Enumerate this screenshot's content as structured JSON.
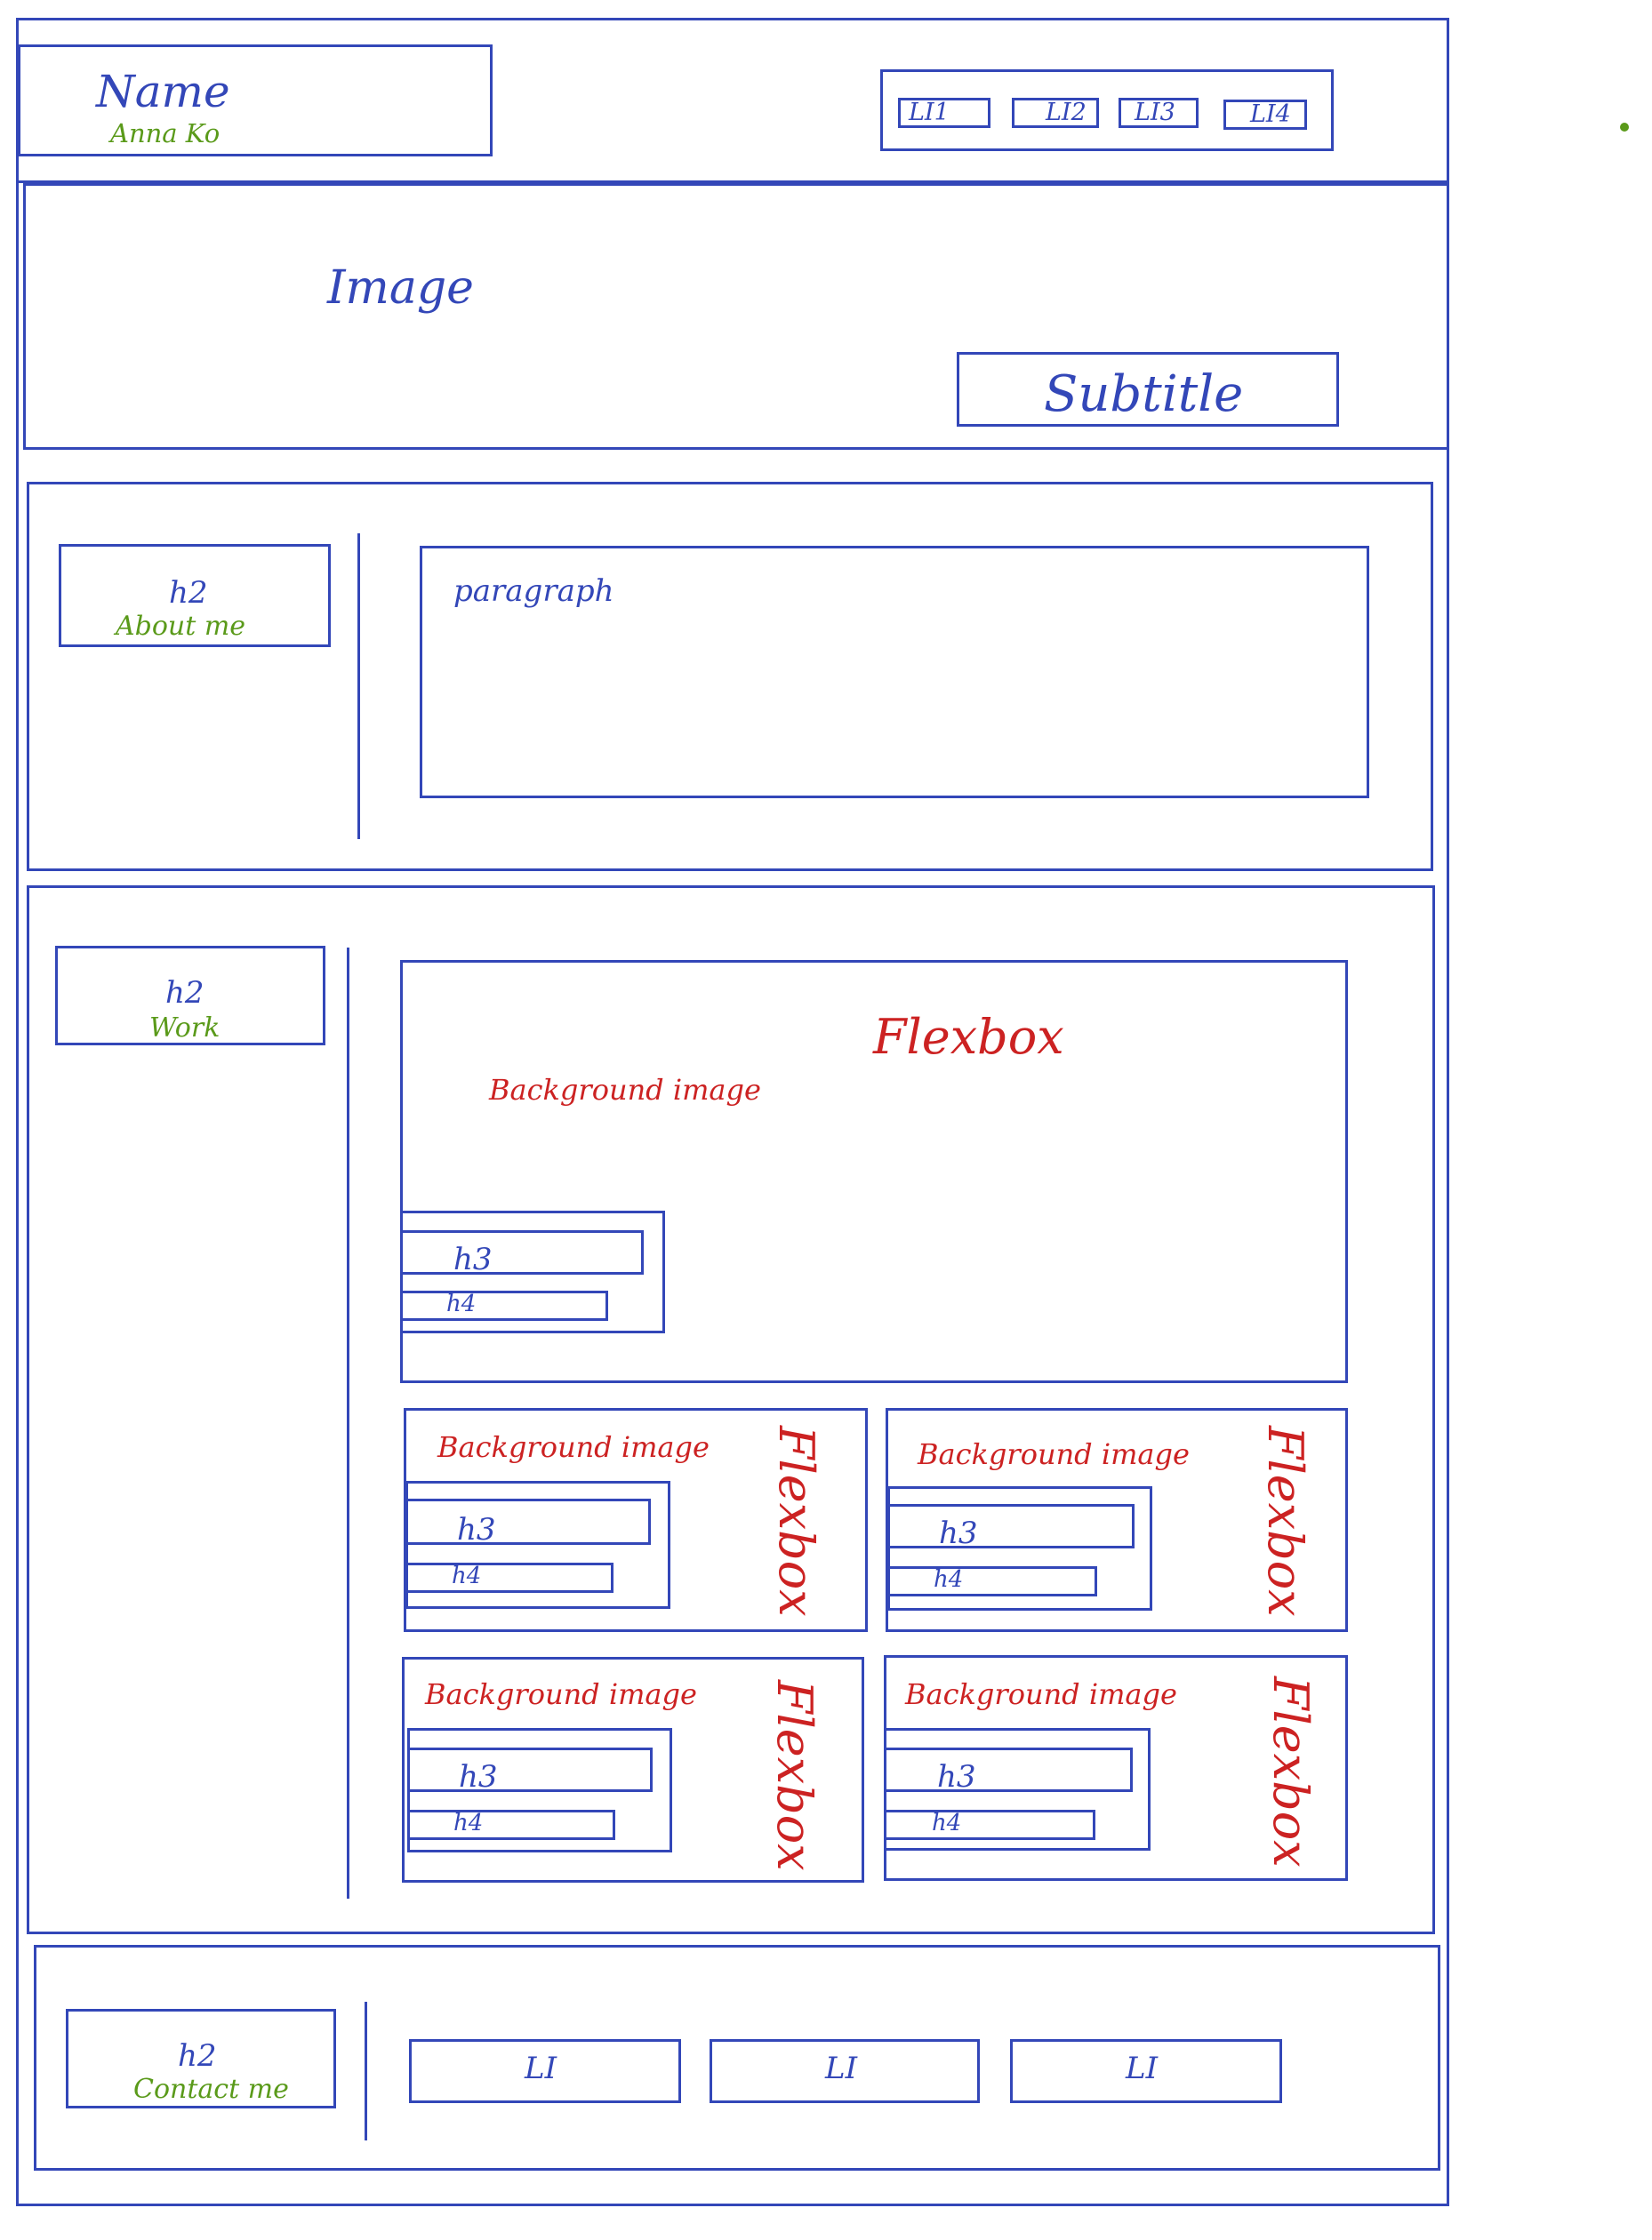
{
  "header": {
    "name_label": "Name",
    "name_value": "Anna Ko",
    "nav": [
      "LI1",
      "LI2",
      "LI3",
      "LI4"
    ]
  },
  "hero": {
    "image_label": "Image",
    "subtitle_label": "Subtitle"
  },
  "about": {
    "heading_tag": "h2",
    "heading_text": "About me",
    "paragraph_label": "paragraph"
  },
  "work": {
    "heading_tag": "h2",
    "heading_text": "Work",
    "featured": {
      "flex_label": "Flexbox",
      "bg_label": "Background image",
      "h3_label": "h3",
      "h4_label": "h4"
    },
    "cards": [
      {
        "bg_label": "Background image",
        "flex_label": "Flexbox",
        "h3_label": "h3",
        "h4_label": "h4"
      },
      {
        "bg_label": "Background image",
        "flex_label": "Flexbox",
        "h3_label": "h3",
        "h4_label": "h4"
      },
      {
        "bg_label": "Background image",
        "flex_label": "Flexbox",
        "h3_label": "h3",
        "h4_label": "h4"
      },
      {
        "bg_label": "Background image",
        "flex_label": "Flexbox",
        "h3_label": "h3",
        "h4_label": "h4"
      }
    ]
  },
  "contact": {
    "heading_tag": "h2",
    "heading_text": "Contact me",
    "items": [
      "LI",
      "LI",
      "LI"
    ]
  },
  "colors": {
    "structure": "#3347b8",
    "content_note": "#5a9a1a",
    "layout_note": "#cc2222"
  }
}
